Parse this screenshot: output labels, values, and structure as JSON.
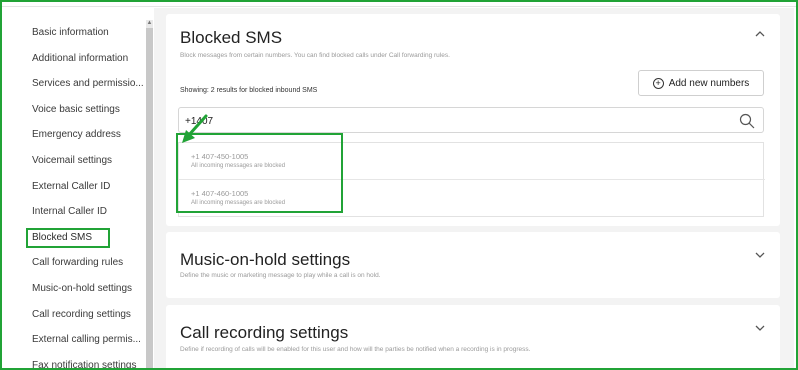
{
  "sidebar": {
    "items": [
      {
        "label": "Basic information"
      },
      {
        "label": "Additional information"
      },
      {
        "label": "Services and permissio..."
      },
      {
        "label": "Voice basic settings"
      },
      {
        "label": "Emergency address"
      },
      {
        "label": "Voicemail settings"
      },
      {
        "label": "External Caller ID"
      },
      {
        "label": "Internal Caller ID"
      },
      {
        "label": "Blocked SMS"
      },
      {
        "label": "Call forwarding rules"
      },
      {
        "label": "Music-on-hold settings"
      },
      {
        "label": "Call recording settings"
      },
      {
        "label": "External calling permis..."
      },
      {
        "label": "Fax notification settings"
      }
    ]
  },
  "blocked_sms": {
    "title": "Blocked SMS",
    "subtitle": "Block messages from certain numbers. You can find blocked calls under Call forwarding rules.",
    "showing": "Showing: 2 results for blocked inbound SMS",
    "add_button": "Add new numbers",
    "search_value": "+1407",
    "results": [
      {
        "number": "+1 407-450-1005",
        "note": "All incoming messages are blocked"
      },
      {
        "number": "+1 407-460-1005",
        "note": "All incoming messages are blocked"
      }
    ]
  },
  "music_on_hold": {
    "title": "Music-on-hold settings",
    "subtitle": "Define the music or marketing message to play while a call is on hold."
  },
  "call_recording": {
    "title": "Call recording settings",
    "subtitle": "Define if recording of calls will be enabled for this user and how will the parties be notified when a recording is in progress."
  },
  "colors": {
    "highlight": "#21a336",
    "background": "#f3f3f3"
  },
  "icons": {
    "search": "search-icon",
    "add": "plus-circle-icon",
    "collapse": "chevron-up-icon",
    "expand": "chevron-down-icon"
  }
}
